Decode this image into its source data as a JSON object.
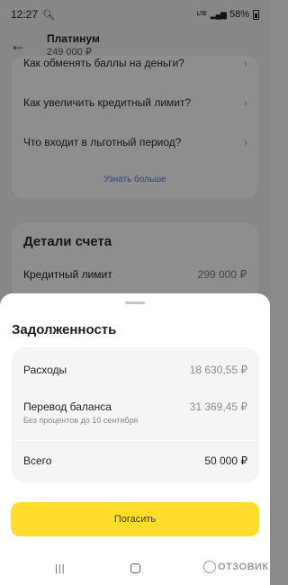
{
  "status_bar": {
    "time": "12:27",
    "battery": "58%"
  },
  "header": {
    "title": "Платинум",
    "subtitle": "249 000 ₽"
  },
  "faq": {
    "items": [
      {
        "label": "Как обменять баллы на деньги?"
      },
      {
        "label": "Как увеличить кредитный лимит?"
      },
      {
        "label": "Что входит в льготный период?"
      }
    ],
    "more_label": "Узнать больше"
  },
  "account_details": {
    "title": "Детали счета",
    "credit_limit_label": "Кредитный лимит",
    "credit_limit_value": "299 000 ₽"
  },
  "debt_sheet": {
    "title": "Задолженность",
    "rows": [
      {
        "label": "Расходы",
        "value": "18 630,55 ₽"
      },
      {
        "label": "Перевод баланса",
        "value": "31 369,45 ₽",
        "note": "Без процентов до 10 сентября"
      }
    ],
    "total_label": "Всего",
    "total_value": "50 000 ₽",
    "pay_button_label": "Погасить"
  },
  "watermark": "ОТЗОВИК",
  "colors": {
    "accent_yellow": "#ffdd2d",
    "link_blue": "#5a74b4"
  }
}
